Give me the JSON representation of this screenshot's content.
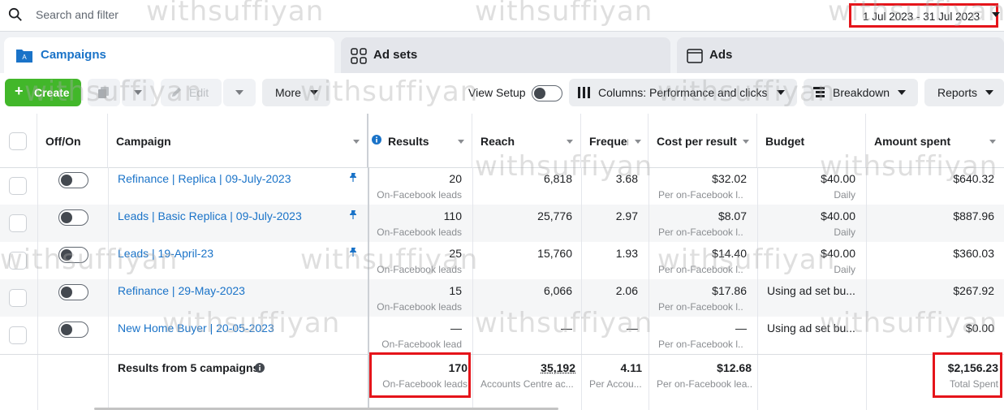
{
  "search": {
    "placeholder": "Search and filter"
  },
  "date_range": "1 Jul 2023 - 31 Jul 2023",
  "tabs": [
    {
      "label": "Campaigns"
    },
    {
      "label": "Ad sets"
    },
    {
      "label": "Ads"
    }
  ],
  "toolbar": {
    "create": "Create",
    "edit": "Edit",
    "more": "More",
    "view_setup": "View Setup",
    "columns": "Columns: Performance and clicks",
    "breakdown": "Breakdown",
    "reports": "Reports"
  },
  "columns": [
    "Off/On",
    "Campaign",
    "Results",
    "Reach",
    "Frequer",
    "Cost per result",
    "Budget",
    "Amount spent"
  ],
  "rows": [
    {
      "campaign": "Refinance | Replica | 09-July-2023",
      "results": "20",
      "results_sub": "On-Facebook leads",
      "reach": "6,818",
      "frequency": "3.68",
      "cost": "$32.02",
      "cost_sub": "Per on-Facebook l...",
      "budget": "$40.00",
      "budget_sub": "Daily",
      "spent": "$640.32",
      "pinned": true
    },
    {
      "campaign": "Leads | Basic Replica | 09-July-2023",
      "results": "110",
      "results_sub": "On-Facebook leads",
      "reach": "25,776",
      "frequency": "2.97",
      "cost": "$8.07",
      "cost_sub": "Per on-Facebook l...",
      "budget": "$40.00",
      "budget_sub": "Daily",
      "spent": "$887.96",
      "pinned": true
    },
    {
      "campaign": "Leads | 19-April-23",
      "results": "25",
      "results_sub": "On-Facebook leads",
      "reach": "15,760",
      "frequency": "1.93",
      "cost": "$14.40",
      "cost_sub": "Per on-Facebook l...",
      "budget": "$40.00",
      "budget_sub": "Daily",
      "spent": "$360.03",
      "pinned": true
    },
    {
      "campaign": "Refinance | 29-May-2023",
      "results": "15",
      "results_sub": "On-Facebook leads",
      "reach": "6,066",
      "frequency": "2.06",
      "cost": "$17.86",
      "cost_sub": "Per on-Facebook l...",
      "budget": "Using ad set bu...",
      "budget_sub": "",
      "spent": "$267.92",
      "pinned": false
    },
    {
      "campaign": "New Home Buyer | 20-05-2023",
      "results": "—",
      "results_sub": "On-Facebook lead",
      "reach": "—",
      "frequency": "—",
      "cost": "—",
      "cost_sub": "Per on-Facebook l...",
      "budget": "Using ad set bu...",
      "budget_sub": "",
      "spent": "$0.00",
      "pinned": false
    }
  ],
  "totals": {
    "label": "Results from 5 campaigns",
    "results": "170",
    "results_sub": "On-Facebook leads",
    "reach": "35,192",
    "reach_sub": "Accounts Centre ac...",
    "frequency": "4.11",
    "frequency_sub": "Per Accou...",
    "cost": "$12.68",
    "cost_sub": "Per on-Facebook lea...",
    "spent": "$2,156.23",
    "spent_sub": "Total Spent"
  },
  "watermark": "withsuffiyan",
  "colors": {
    "accent": "#1a73c8",
    "create": "#42b72a",
    "highlight": "#e5141a"
  }
}
